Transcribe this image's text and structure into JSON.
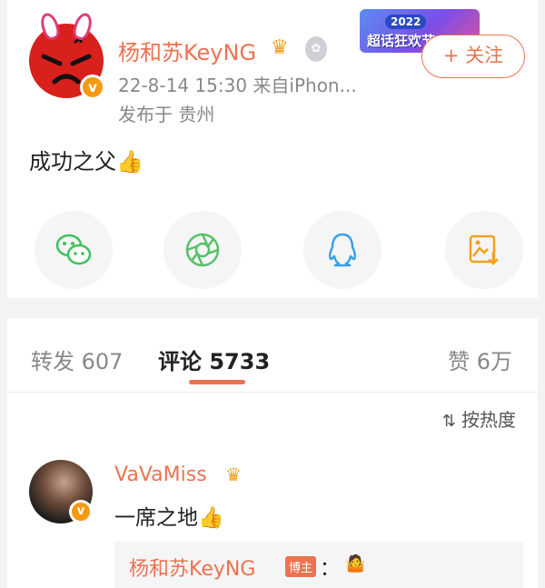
{
  "post": {
    "author": "杨和苏KeyNG",
    "verified_mark": "v",
    "meta": "22-8-14 15:30  来自iPhon...",
    "location": "发布于 贵州",
    "banner_year": "2022",
    "banner_name": "超话狂欢节",
    "follow_label": "+ 关注",
    "text": "成功之父👍"
  },
  "share": {
    "icons": [
      "wechat-icon",
      "moments-icon",
      "qq-icon",
      "save-image-icon"
    ],
    "colors": {
      "wechat": "#3cc35a",
      "moments": "#56c06a",
      "qq": "#3aa0e8",
      "save": "#f0a020"
    }
  },
  "tabs": {
    "repost": "转发 607",
    "comment": "评论 5733",
    "like": "赞 6万"
  },
  "sort": {
    "label": "按热度"
  },
  "comment": {
    "author": "VaVaMiss",
    "text": "一席之地👍",
    "reply_author": "杨和苏KeyNG",
    "reply_tag": "博主",
    "reply_colon": "：",
    "reply_emoji": "🤷"
  },
  "colors": {
    "accent": "#eb7350",
    "muted": "#888888"
  }
}
